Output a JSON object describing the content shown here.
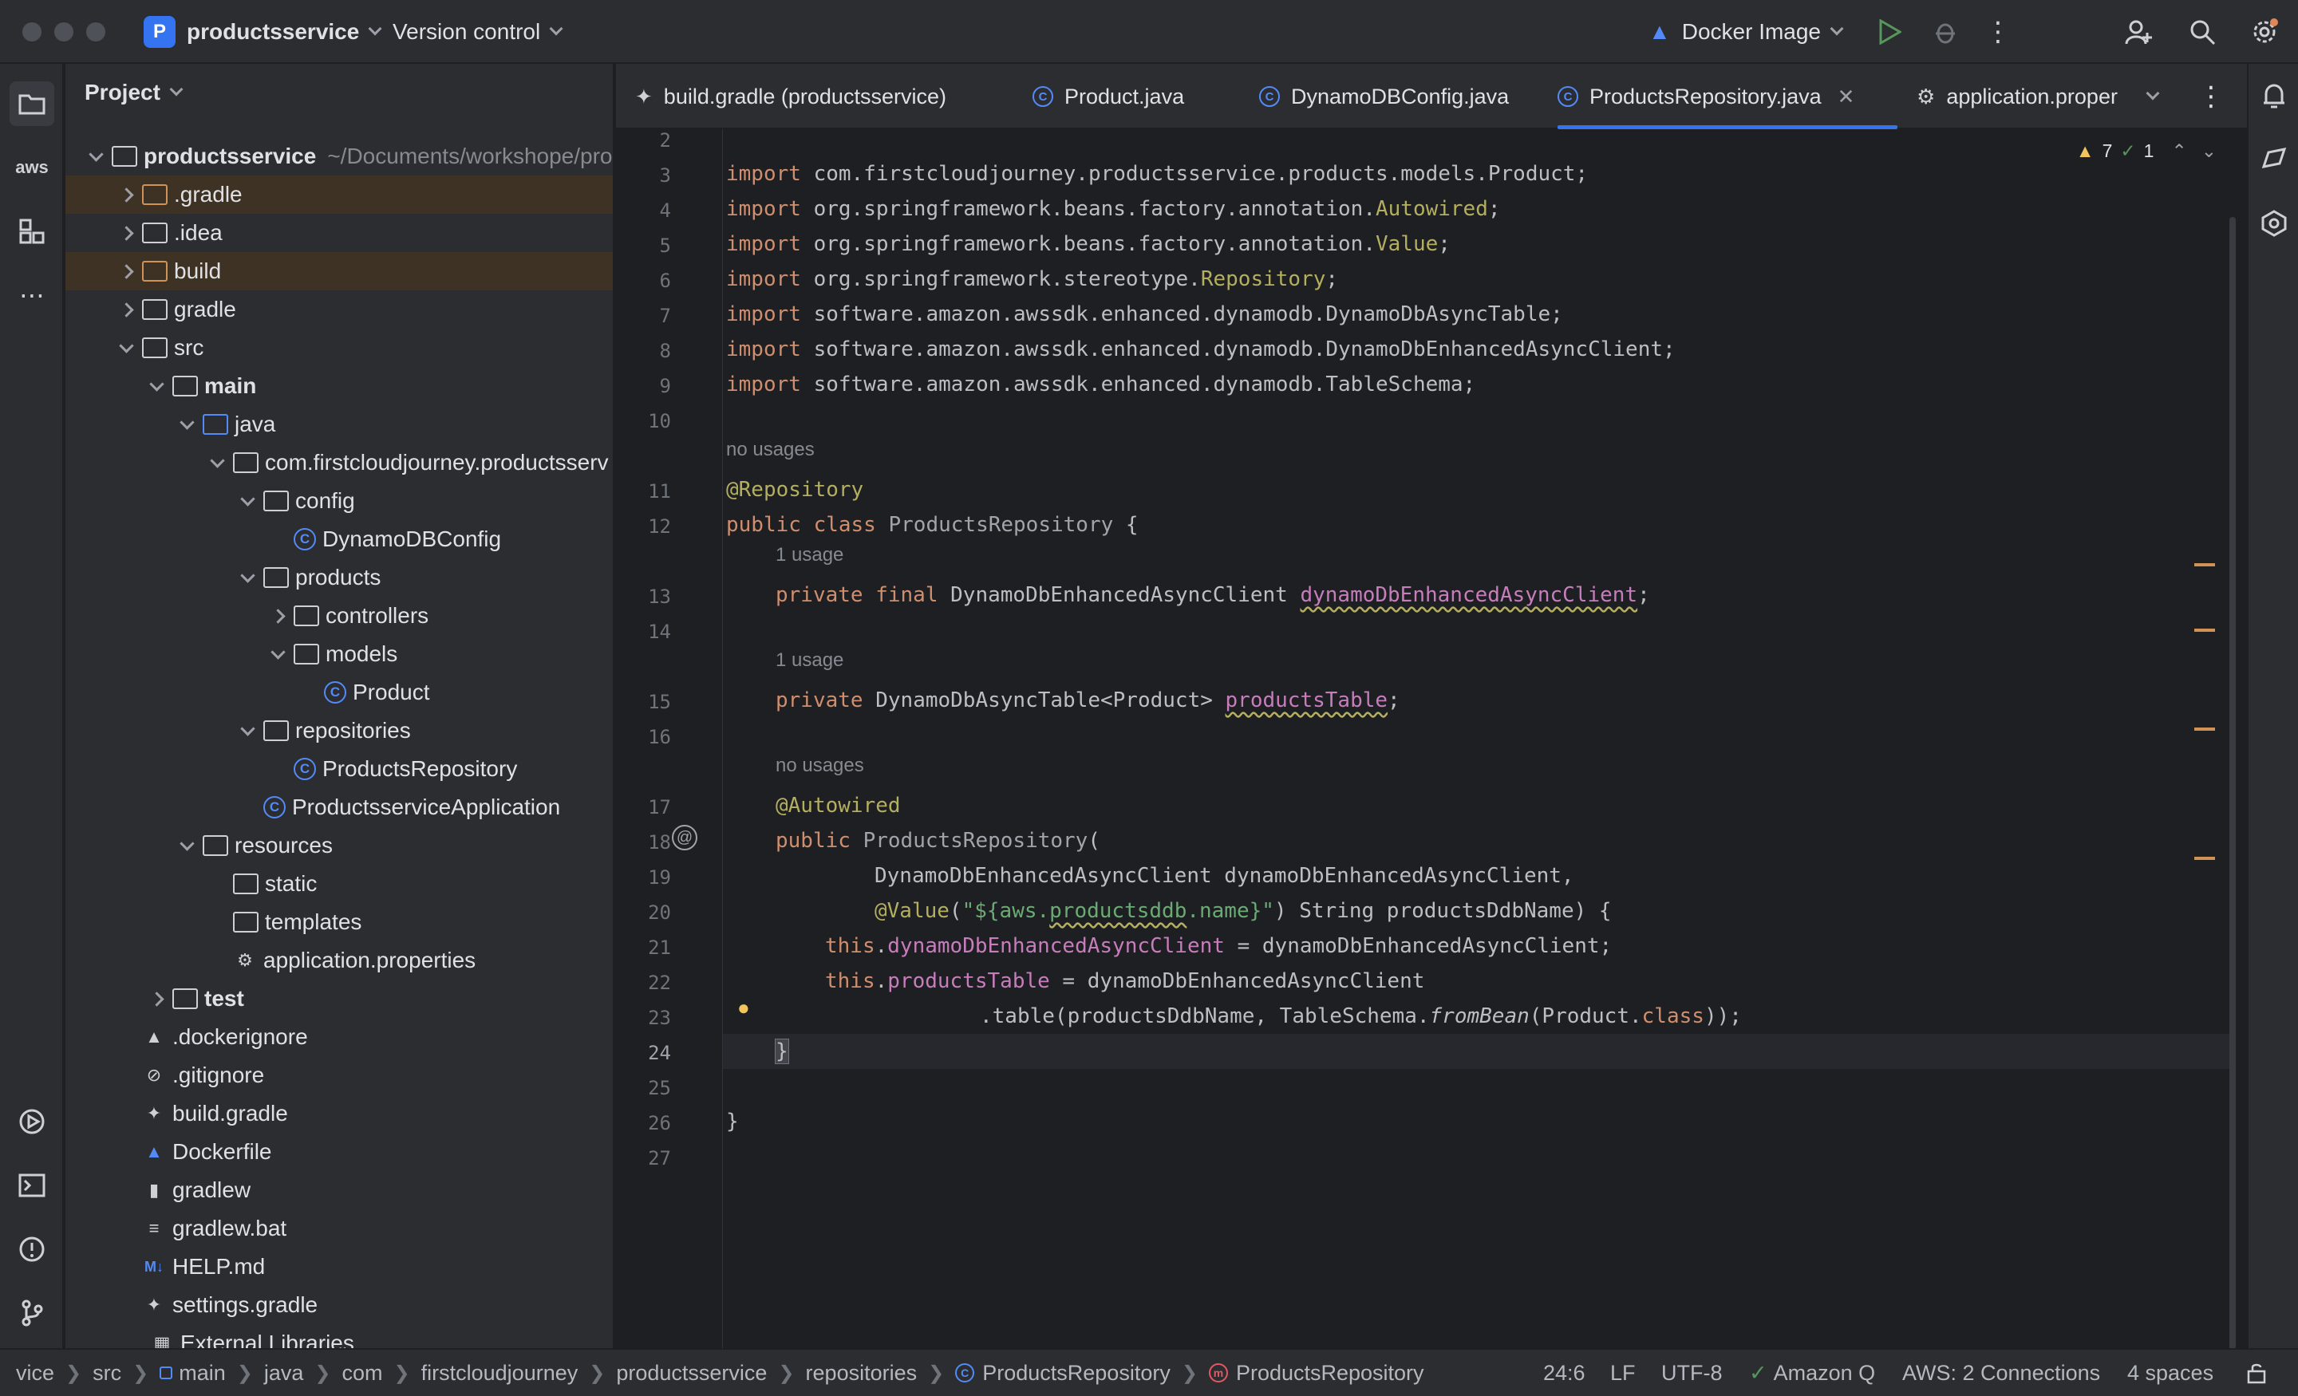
{
  "titlebar": {
    "project_badge": "P",
    "project_name": "productsservice",
    "version_control": "Version control",
    "run_config": "Docker Image"
  },
  "project_panel": {
    "title": "Project",
    "tree": [
      {
        "label": "productsservice",
        "path": "~/Documents/workshope/pro"
      },
      {
        "label": ".gradle"
      },
      {
        "label": ".idea"
      },
      {
        "label": "build"
      },
      {
        "label": "gradle"
      },
      {
        "label": "src"
      },
      {
        "label": "main"
      },
      {
        "label": "java"
      },
      {
        "label": "com.firstcloudjourney.productsserv"
      },
      {
        "label": "config"
      },
      {
        "label": "DynamoDBConfig"
      },
      {
        "label": "products"
      },
      {
        "label": "controllers"
      },
      {
        "label": "models"
      },
      {
        "label": "Product"
      },
      {
        "label": "repositories"
      },
      {
        "label": "ProductsRepository"
      },
      {
        "label": "ProductsserviceApplication"
      },
      {
        "label": "resources"
      },
      {
        "label": "static"
      },
      {
        "label": "templates"
      },
      {
        "label": "application.properties"
      },
      {
        "label": "test"
      },
      {
        "label": ".dockerignore"
      },
      {
        "label": ".gitignore"
      },
      {
        "label": "build.gradle"
      },
      {
        "label": "Dockerfile"
      },
      {
        "label": "gradlew"
      },
      {
        "label": "gradlew.bat"
      },
      {
        "label": "HELP.md"
      },
      {
        "label": "settings.gradle"
      },
      {
        "label": "External Libraries"
      }
    ]
  },
  "tabs": [
    {
      "label": "build.gradle (productsservice)"
    },
    {
      "label": "Product.java"
    },
    {
      "label": "DynamoDBConfig.java"
    },
    {
      "label": "ProductsRepository.java"
    },
    {
      "label": "application.proper"
    }
  ],
  "inspections": {
    "warnings": "7",
    "ok": "1"
  },
  "editor": {
    "line_numbers": [
      "2",
      "3",
      "4",
      "5",
      "6",
      "7",
      "8",
      "9",
      "10",
      "11",
      "12",
      "13",
      "14",
      "15",
      "16",
      "17",
      "18",
      "19",
      "20",
      "21",
      "22",
      "23",
      "24",
      "25",
      "26",
      "27"
    ],
    "hints": {
      "no_usages_1": "no usages",
      "usage_1": "1 usage",
      "usage_2": "1 usage",
      "no_usages_2": "no usages"
    },
    "code": {
      "l3a": "import ",
      "l3b": "com.firstcloudjourney.productsservice.products.models.Product;",
      "l4a": "import ",
      "l4b": "org.springframework.beans.factory.annotation.",
      "l4c": "Autowired",
      "l4d": ";",
      "l5a": "import ",
      "l5b": "org.springframework.beans.factory.annotation.",
      "l5c": "Value",
      "l5d": ";",
      "l6a": "import ",
      "l6b": "org.springframework.stereotype.",
      "l6c": "Repository",
      "l6d": ";",
      "l7a": "import ",
      "l7b": "software.amazon.awssdk.enhanced.dynamodb.DynamoDbAsyncTable;",
      "l8a": "import ",
      "l8b": "software.amazon.awssdk.enhanced.dynamodb.DynamoDbEnhancedAsyncClient;",
      "l9a": "import ",
      "l9b": "software.amazon.awssdk.enhanced.dynamodb.TableSchema;",
      "l11": "@Repository",
      "l12a": "public class ",
      "l12b": "ProductsRepository",
      "l12c": " {",
      "l13a": "private final ",
      "l13b": "DynamoDbEnhancedAsyncClient ",
      "l13c": "dynamoDbEnhancedAsyncClient",
      "l13d": ";",
      "l15a": "private ",
      "l15b": "DynamoDbAsyncTable<Product> ",
      "l15c": "productsTable",
      "l15d": ";",
      "l17": "@Autowired",
      "l18a": "public ",
      "l18b": "ProductsRepository",
      "l18c": "(",
      "l19": "DynamoDbEnhancedAsyncClient dynamoDbEnhancedAsyncClient,",
      "l20a": "@Value",
      "l20b": "(",
      "l20c": "\"${aws.",
      "l20d": "productsddb",
      "l20e": ".name}\"",
      "l20f": ") String productsDdbName) {",
      "l21a": "this",
      "l21b": ".",
      "l21c": "dynamoDbEnhancedAsyncClient",
      "l21d": " = dynamoDbEnhancedAsyncClient;",
      "l22a": "this",
      "l22b": ".",
      "l22c": "productsTable",
      "l22d": " = dynamoDbEnhancedAsyncClient",
      "l23a": ".table(productsDdbName, TableSchema.",
      "l23b": "fromBean",
      "l23c": "(Product.",
      "l23d": "class",
      "l23e": "));",
      "l24": "}",
      "l26": "}"
    }
  },
  "statusbar": {
    "breadcrumbs": [
      "vice",
      "src",
      "main",
      "java",
      "com",
      "firstcloudjourney",
      "productsservice",
      "repositories",
      "ProductsRepository",
      "ProductsRepository"
    ],
    "position": "24:6",
    "line_sep": "LF",
    "encoding": "UTF-8",
    "amazon_q": "Amazon Q",
    "aws": "AWS: 2 Connections",
    "indent": "4 spaces"
  },
  "colors": {
    "accent": "#3574f0",
    "keyword": "#cf8e6d",
    "annotation": "#b3ae60",
    "field": "#c77dbb",
    "string": "#6aab73"
  }
}
